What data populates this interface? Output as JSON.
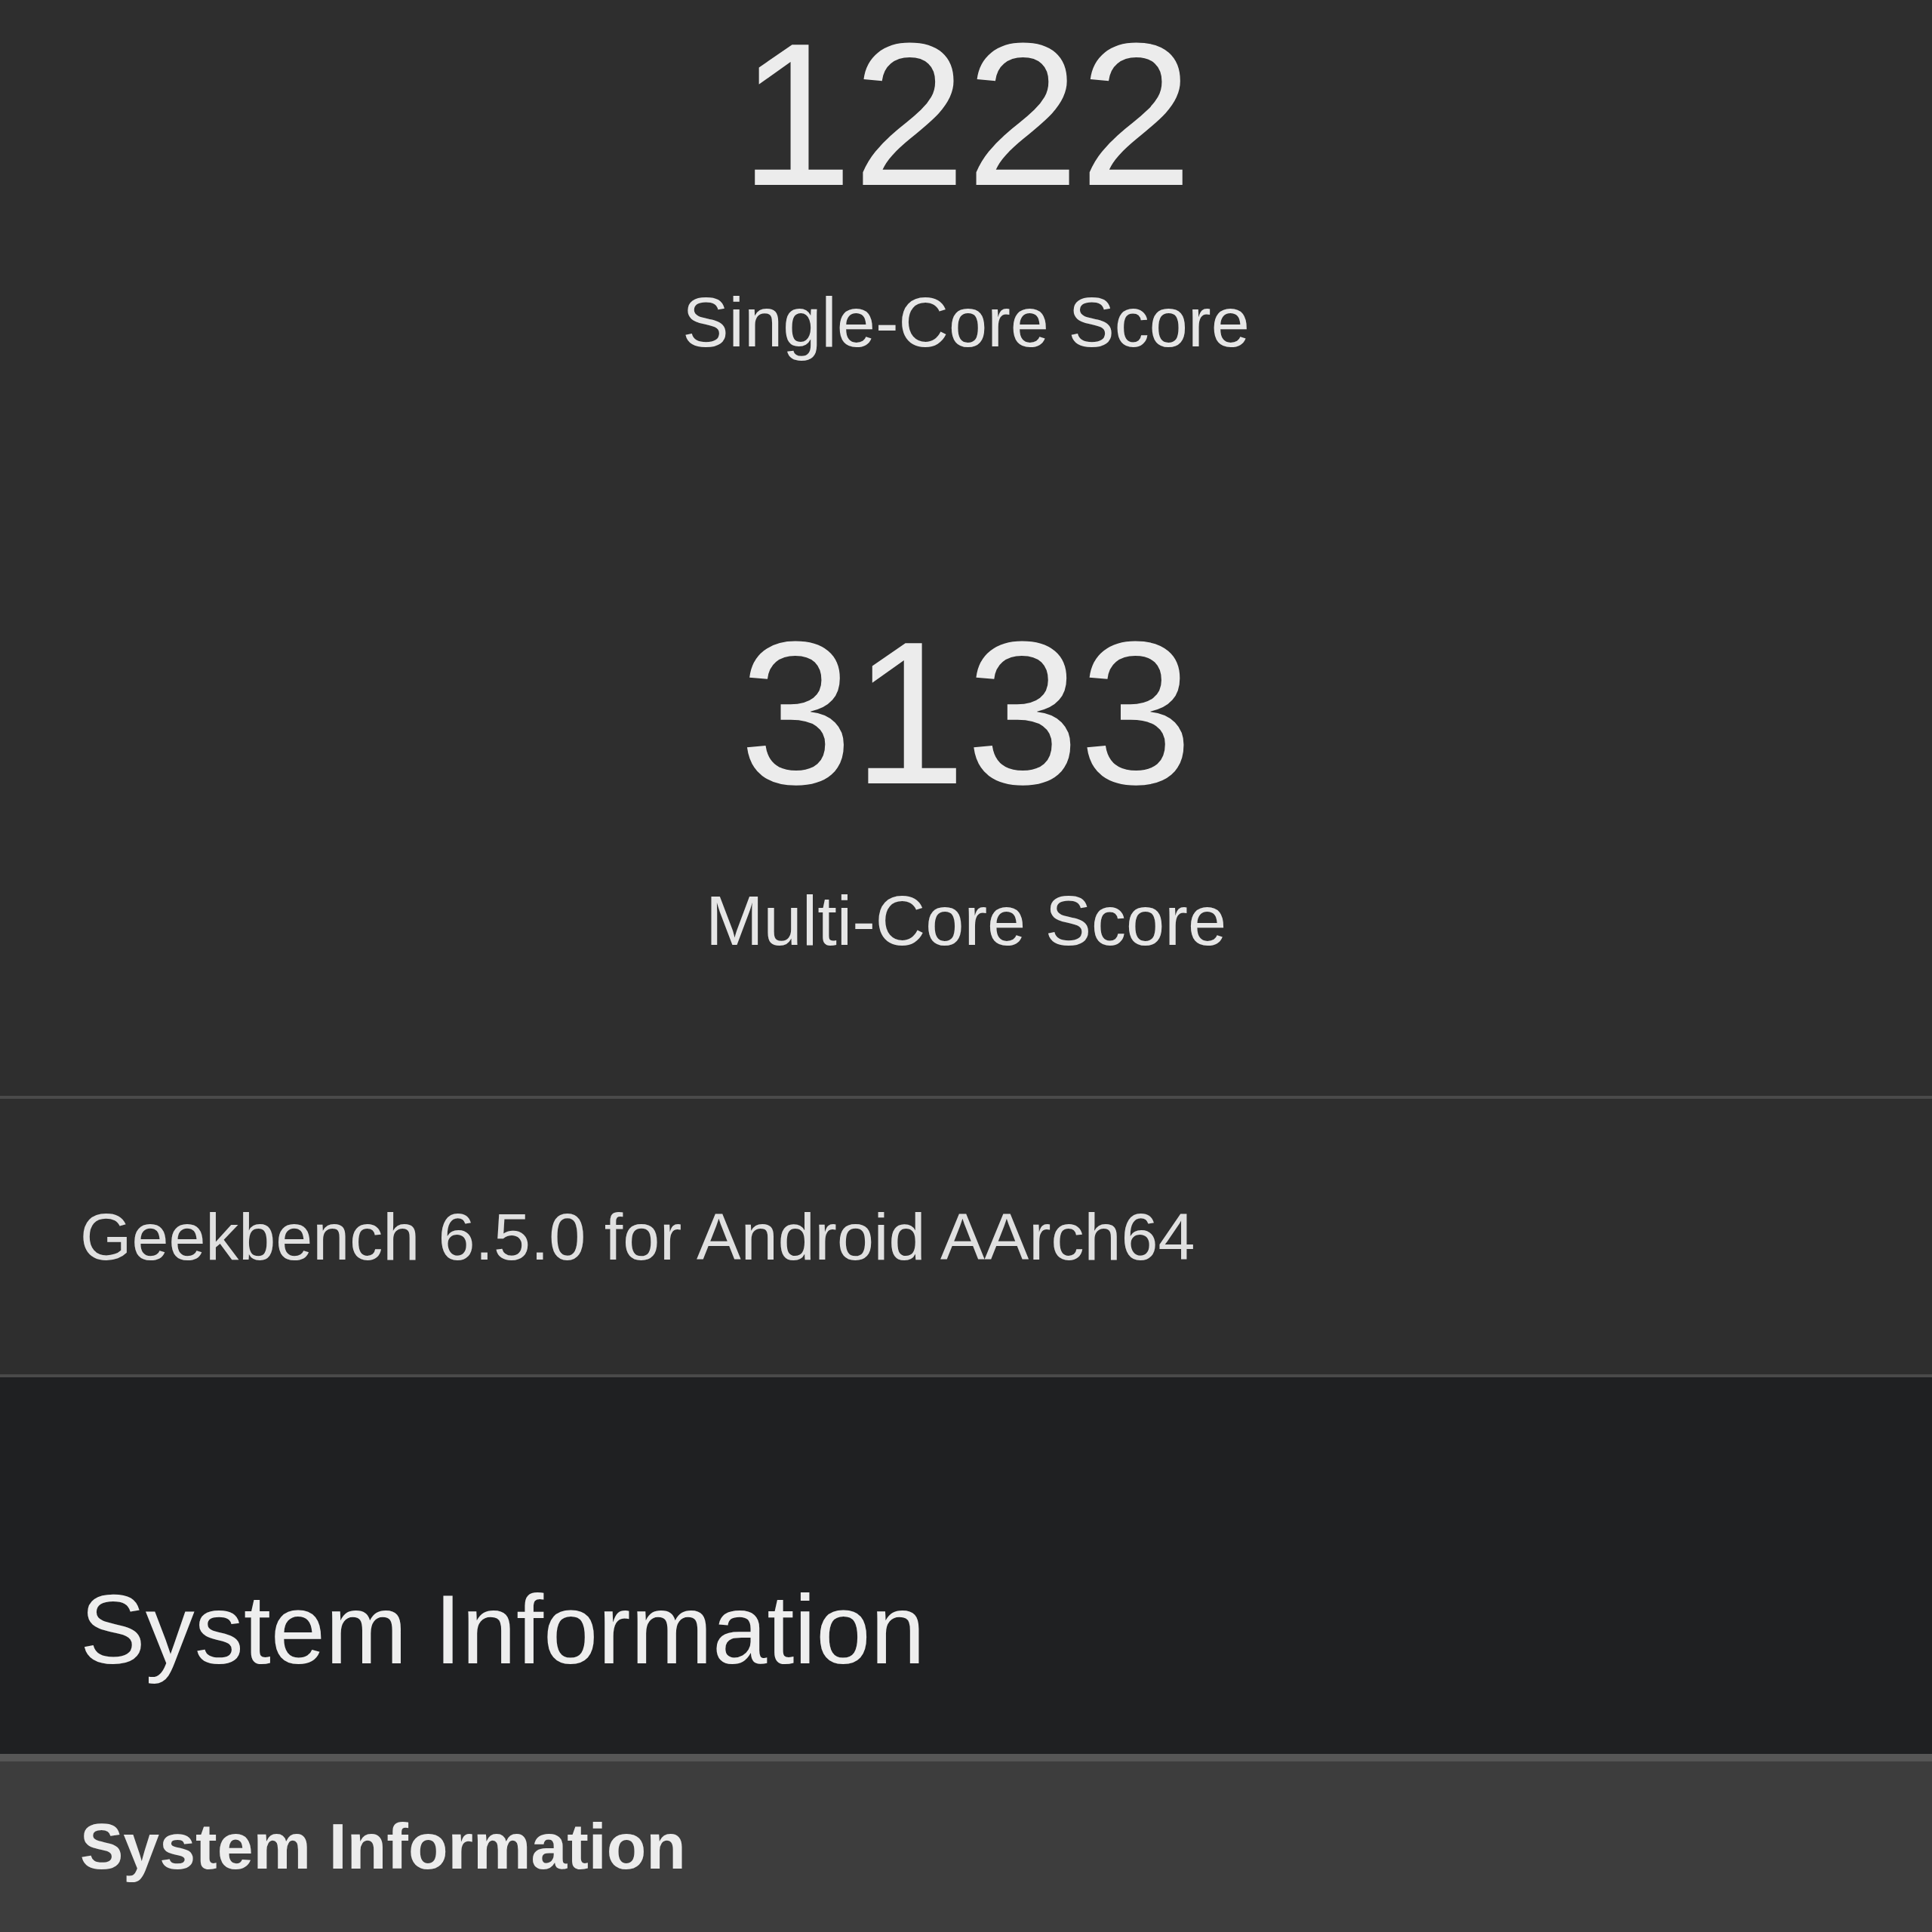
{
  "scores": [
    {
      "value": "1222",
      "label": "Single-Core Score"
    },
    {
      "value": "3133",
      "label": "Multi-Core Score"
    }
  ],
  "version": "Geekbench 6.5.0 for Android AArch64",
  "section_title": "System Information",
  "table_header": "System Information"
}
